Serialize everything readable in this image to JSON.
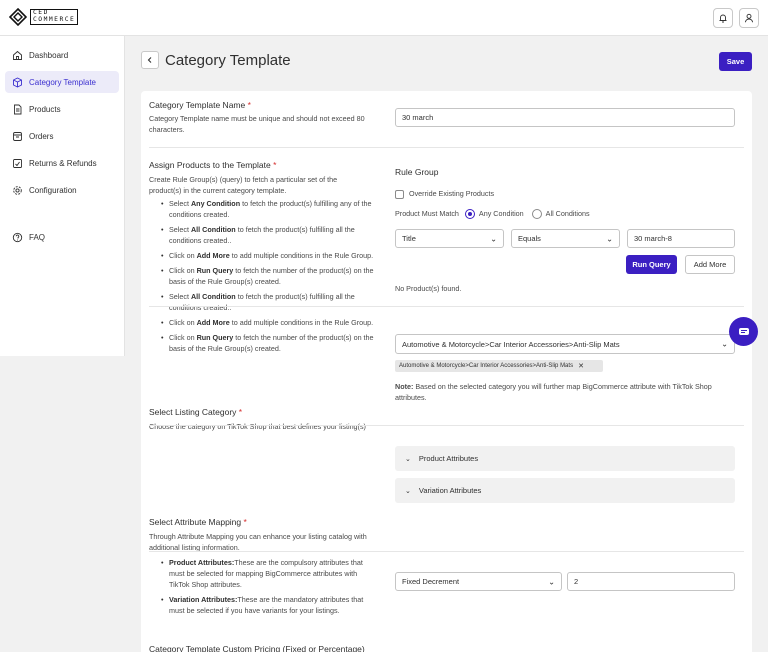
{
  "brand": {
    "line1": "CED",
    "line2": "COMMERCE"
  },
  "sidebar": {
    "items": [
      {
        "label": "Dashboard",
        "icon": "home-icon"
      },
      {
        "label": "Category Template",
        "icon": "cube-icon",
        "active": true
      },
      {
        "label": "Products",
        "icon": "document-icon"
      },
      {
        "label": "Orders",
        "icon": "inbox-icon"
      },
      {
        "label": "Returns & Refunds",
        "icon": "returns-icon"
      },
      {
        "label": "Configuration",
        "icon": "gear-icon"
      },
      {
        "label": "FAQ",
        "icon": "question-icon"
      }
    ]
  },
  "page": {
    "title": "Category Template",
    "save_label": "Save"
  },
  "template_name": {
    "title": "Category Template Name",
    "required": "*",
    "desc": "Category Template name must be unique and should not exceed 80 characters.",
    "value": "30 march"
  },
  "assign": {
    "title": "Assign Products to the Template",
    "required": "*",
    "desc": "Create Rule Group(s) (query) to fetch a particular set of the product(s) in the current category template.",
    "bullets": [
      {
        "pre": "Select ",
        "bold": "Any Condition",
        "post": " to fetch the product(s) fulfilling any of the conditions created."
      },
      {
        "pre": "Select ",
        "bold": "All Condition",
        "post": " to fetch the product(s) fulfilling all the conditions created.."
      },
      {
        "pre": "Click on ",
        "bold": "Add More",
        "post": " to add multiple conditions in the Rule Group."
      },
      {
        "pre": "Click on ",
        "bold": "Run Query",
        "post": " to fetch the number of the product(s) on the basis of the Rule Group(s) created."
      },
      {
        "pre": "Select ",
        "bold": "All Condition",
        "post": " to fetch the product(s) fulfilling all the conditions created.."
      },
      {
        "pre": "Click on ",
        "bold": "Add More",
        "post": " to add multiple conditions in the Rule Group."
      },
      {
        "pre": "Click on ",
        "bold": "Run Query",
        "post": " to fetch the number of the product(s) on the basis of the Rule Group(s) created."
      }
    ]
  },
  "rule_group": {
    "title": "Rule Group",
    "override_label": "Override Existing Products",
    "match_label": "Product Must Match",
    "any_label": "Any Condition",
    "all_label": "All Conditions",
    "field": "Title",
    "operator": "Equals",
    "value": "30 march-8",
    "run_query_label": "Run Query",
    "add_more_label": "Add More",
    "result": "No Product(s) found."
  },
  "listing_category": {
    "title": "Select Listing Category",
    "required": "*",
    "desc": "Choose the category on TikTok Shop that best defines your listing(s)",
    "selected": "Automotive & Motorcycle>Car Interior Accessories>Anti-Slip Mats",
    "tag": "Automotive & Motorcycle>Car Interior Accessories>Anti-Slip Mats",
    "note_label": "Note:",
    "note_text": " Based on the selected category you will further map BigCommerce attribute with TikTok Shop attributes.",
    "accordion_1": "Product Attributes",
    "accordion_2": "Variation Attributes"
  },
  "attribute_mapping": {
    "title": "Select Attribute Mapping",
    "required": "*",
    "desc": "Through Attribute Mapping you can enhance your listing catalog with additional listing information.",
    "bullets": [
      {
        "bold": "Product Attributes:",
        "post": "These are the compulsory attributes that must be selected for mapping  BigCommerce  attributes with TikTok Shop attributes."
      },
      {
        "bold": "Variation Attributes:",
        "post": "These are the mandatory attributes that must be selected if you have variants for your listings."
      }
    ]
  },
  "pricing": {
    "title": "Category Template Custom Pricing (Fixed or Percentage)",
    "type": "Fixed Decrement",
    "value": "2"
  }
}
